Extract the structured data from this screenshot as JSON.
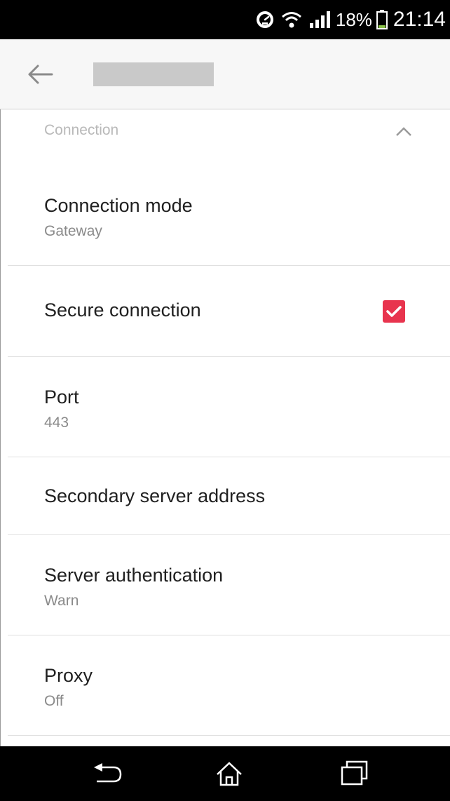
{
  "status_bar": {
    "battery_percent": "18%",
    "time": "21:14",
    "icons": [
      "speedometer-icon",
      "wifi-icon",
      "signal-icon",
      "battery-icon"
    ]
  },
  "app_bar": {
    "icons": [
      "back-arrow-icon"
    ]
  },
  "section": {
    "title": "Connection",
    "icons": [
      "chevron-up-icon"
    ]
  },
  "settings": [
    {
      "title": "Connection mode",
      "subtitle": "Gateway"
    },
    {
      "title": "Secure connection",
      "checked": true
    },
    {
      "title": "Port",
      "subtitle": "443"
    },
    {
      "title": "Secondary server address"
    },
    {
      "title": "Server authentication",
      "subtitle": "Warn"
    },
    {
      "title": "Proxy",
      "subtitle": "Off"
    }
  ],
  "colors": {
    "accent": "#e8344e",
    "status_bar": "#000000",
    "app_bar": "#f7f7f7"
  },
  "nav_bar": {
    "icons": [
      "back-icon",
      "home-icon",
      "recent-apps-icon"
    ]
  }
}
